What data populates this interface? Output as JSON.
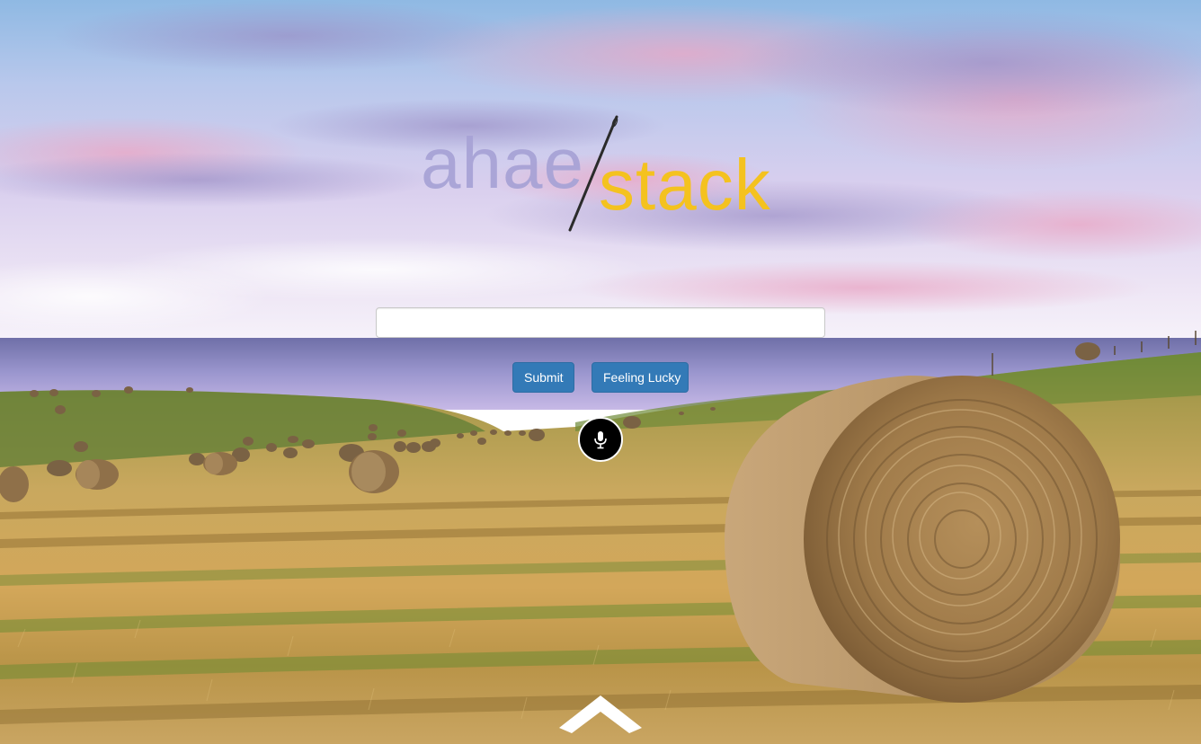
{
  "logo": {
    "left_text": "ahae",
    "right_text": "stack",
    "left_color": "#a8a3d6",
    "right_color": "#f4c21f",
    "needle_icon": "needle-icon"
  },
  "search": {
    "value": "",
    "placeholder": ""
  },
  "buttons": {
    "submit_label": "Submit",
    "lucky_label": "Feeling Lucky",
    "color": "#337ab7"
  },
  "mic": {
    "icon": "microphone-icon"
  },
  "scroll": {
    "icon": "chevron-up-icon"
  },
  "background": {
    "description_icon": "hay-field-landscape"
  }
}
